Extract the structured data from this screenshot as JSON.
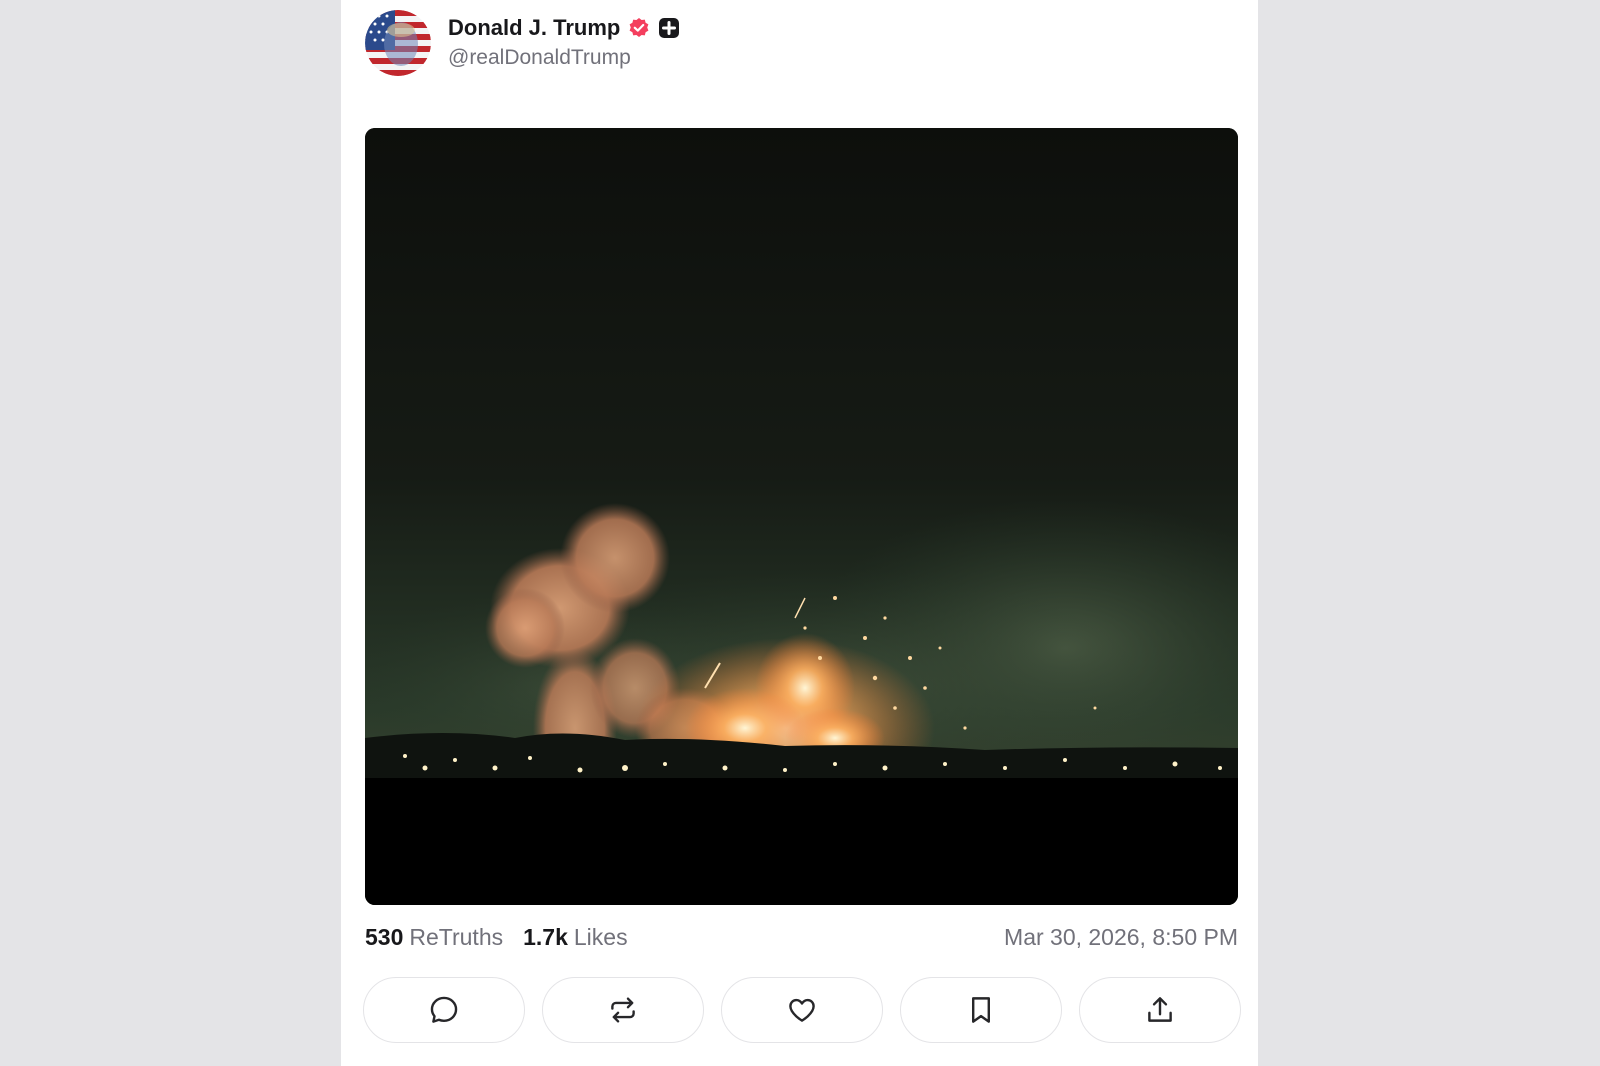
{
  "post": {
    "author": {
      "display_name": "Donald J. Trump",
      "handle": "@realDonaldTrump",
      "avatar_icon": "flag-portrait-avatar",
      "verified_icon": "verified-badge-icon",
      "verified_color": "#f43f5e",
      "plus_icon": "plus-badge-icon"
    },
    "media": {
      "type": "video-still",
      "description_icon": "night-explosion-image"
    },
    "stats": {
      "retruths_count": "530",
      "retruths_label": "ReTruths",
      "likes_count": "1.7k",
      "likes_label": "Likes",
      "timestamp": "Mar 30, 2026, 8:50 PM"
    },
    "actions": [
      {
        "name": "reply",
        "icon": "comment-icon"
      },
      {
        "name": "retruth",
        "icon": "repost-icon"
      },
      {
        "name": "like",
        "icon": "heart-icon"
      },
      {
        "name": "bookmark",
        "icon": "bookmark-icon"
      },
      {
        "name": "share",
        "icon": "share-icon"
      }
    ]
  },
  "colors": {
    "page_background": "#e4e4e7",
    "card_background": "#ffffff",
    "text_primary": "#18181b",
    "text_muted": "#71717a"
  }
}
